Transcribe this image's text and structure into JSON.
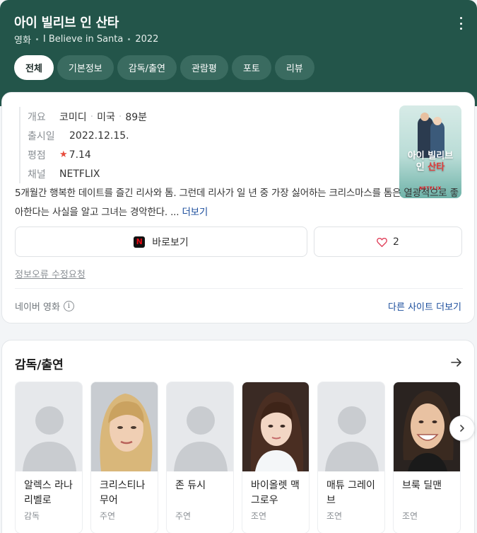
{
  "header": {
    "title": "아이 빌리브 인 산타",
    "subtitle": {
      "type": "영화",
      "original_title": "I Believe in Santa",
      "year": "2022"
    },
    "tabs": [
      "전체",
      "기본정보",
      "감독/출연",
      "관람평",
      "포토",
      "리뷰"
    ],
    "active_tab": "전체",
    "bg_color": "#23554a"
  },
  "info": {
    "summary_label": "개요",
    "genre": "코미디",
    "country": "미국",
    "runtime": "89분",
    "release_label": "출시일",
    "release_date": "2022.12.15.",
    "rating_label": "평점",
    "rating": "7.14",
    "channel_label": "채널",
    "channel": "NETFLIX"
  },
  "poster": {
    "title_line1": "아이 빌리브",
    "title_line2_a": "인 ",
    "title_line2_b": "산타",
    "logo": "NETFLIX"
  },
  "description": {
    "text": "5개월간 행복한 데이트를 즐긴 리사와 톰. 그런데 리사가 일 년 중 가장 싫어하는 크리스마스를 톰은 열광적으로 좋아한다는 사실을 알고 그녀는 경악한다. ...",
    "more": "더보기"
  },
  "actions": {
    "watch_label": "바로보기",
    "watch_icon": "netflix-icon",
    "like_icon": "heart-outline-icon",
    "like_count": "2"
  },
  "footer": {
    "report": "정보오류 수정요청",
    "source": "네이버 영화",
    "more_sites": "다른 사이트 더보기"
  },
  "cast": {
    "title": "감독/출연",
    "people": [
      {
        "name": "알렉스 라나리벨로",
        "role": "감독",
        "photo": "placeholder"
      },
      {
        "name": "크리스티나 무어",
        "role": "주연",
        "photo": "portrait-blonde"
      },
      {
        "name": "존 듀시",
        "role": "주연",
        "photo": "placeholder"
      },
      {
        "name": "바이올렛 맥그로우",
        "role": "조연",
        "photo": "portrait-girl"
      },
      {
        "name": "매튜 그레이브",
        "role": "조연",
        "photo": "placeholder"
      },
      {
        "name": "브룩 딜맨",
        "role": "조연",
        "photo": "portrait-smiling"
      }
    ]
  },
  "colors": {
    "accent_link": "#1b4d9c",
    "star": "#e74c3c",
    "heart": "#e0405a",
    "netflix_red": "#e50914"
  }
}
